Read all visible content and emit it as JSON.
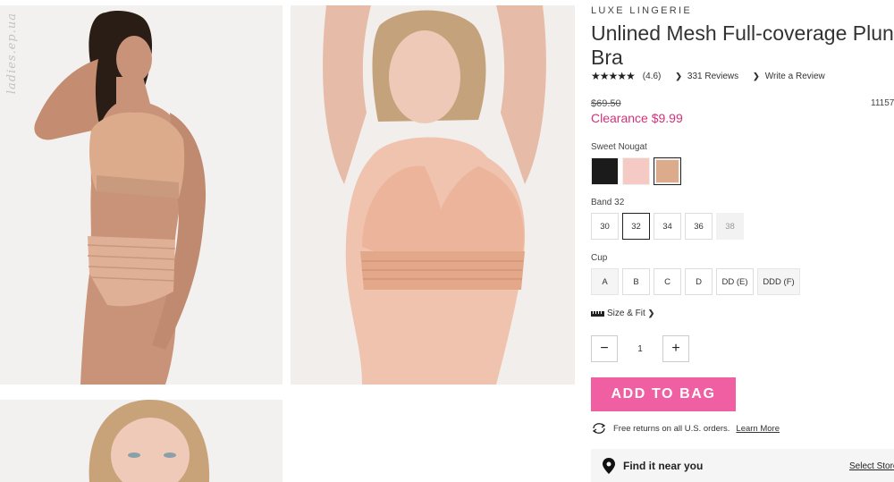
{
  "gallery": {
    "watermark": "ladies.ep.ua"
  },
  "product": {
    "brand": "LUXE LINGERIE",
    "title": "Unlined Mesh Full-coverage Plunge Bra",
    "stars": "★★★★★",
    "rating": "(4.6)",
    "reviews_link": "331 Reviews",
    "write_review_link": "Write a Review",
    "old_price": "$69.50",
    "sku": "11157",
    "clearance_price": "Clearance $9.99"
  },
  "color": {
    "label": "Sweet Nougat",
    "swatches": [
      {
        "name": "black",
        "hex": "#1b1b1b"
      },
      {
        "name": "blush",
        "hex": "#f6cac4"
      },
      {
        "name": "sweet-nougat",
        "hex": "#dcab8c"
      }
    ],
    "selected_index": 2
  },
  "band": {
    "label": "Band 32",
    "options": [
      "30",
      "32",
      "34",
      "36",
      "38"
    ],
    "selected": "32",
    "disabled": [
      "38"
    ]
  },
  "cup": {
    "label": "Cup",
    "options": [
      "A",
      "B",
      "C",
      "D",
      "DD (E)",
      "DDD (F)"
    ]
  },
  "size_fit": {
    "label": "Size & Fit"
  },
  "quantity": {
    "minus": "−",
    "value": "1",
    "plus": "+"
  },
  "cart": {
    "add_label": "ADD TO BAG"
  },
  "returns": {
    "text": "Free returns on all U.S. orders.",
    "link": "Learn More"
  },
  "store": {
    "text": "Find it near you",
    "link": "Select Store"
  },
  "colors": {
    "accent_pink": "#ef5fa1",
    "clearance": "#d4317b"
  }
}
